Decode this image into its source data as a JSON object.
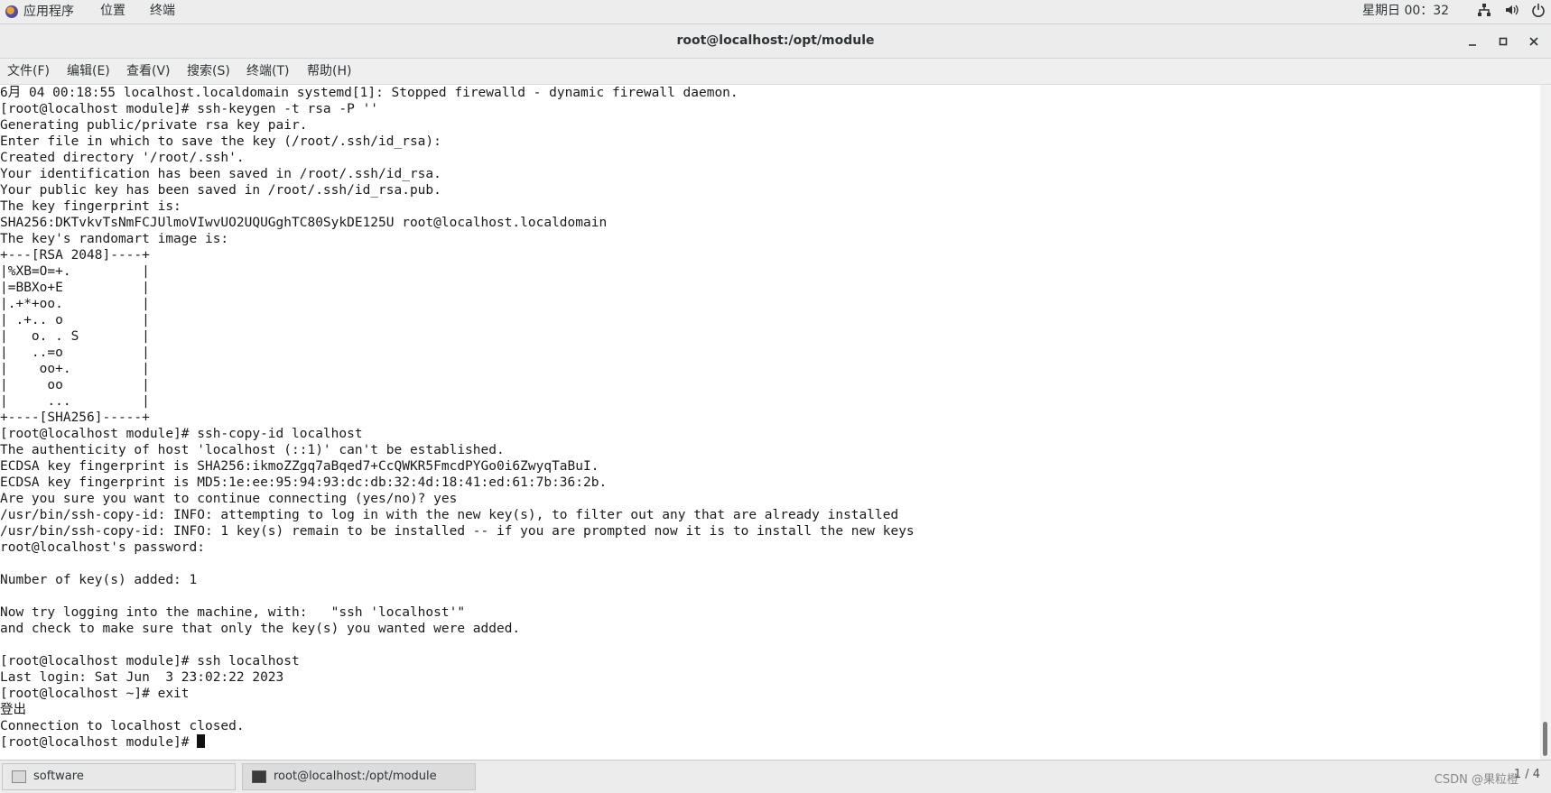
{
  "top_panel": {
    "applications_label": "应用程序",
    "places_label": "位置",
    "terminal_label": "终端",
    "clock": "星期日 00：32",
    "tray_icons": [
      "network-icon",
      "volume-icon",
      "power-icon"
    ]
  },
  "window": {
    "title": "root@localhost:/opt/module"
  },
  "menubar": {
    "items": [
      "文件(F)",
      "编辑(E)",
      "查看(V)",
      "搜索(S)",
      "终端(T)",
      "帮助(H)"
    ]
  },
  "terminal": {
    "lines": [
      "6月 04 00:18:55 localhost.localdomain systemd[1]: Stopped firewalld - dynamic firewall daemon.",
      "[root@localhost module]# ssh-keygen -t rsa -P ''",
      "Generating public/private rsa key pair.",
      "Enter file in which to save the key (/root/.ssh/id_rsa):",
      "Created directory '/root/.ssh'.",
      "Your identification has been saved in /root/.ssh/id_rsa.",
      "Your public key has been saved in /root/.ssh/id_rsa.pub.",
      "The key fingerprint is:",
      "SHA256:DKTvkvTsNmFCJUlmoVIwvUO2UQUGghTC80SykDE125U root@localhost.localdomain",
      "The key's randomart image is:",
      "+---[RSA 2048]----+",
      "|%XB=O=+.         |",
      "|=BBXo+E          |",
      "|.+*+oo.          |",
      "| .+.. o          |",
      "|   o. . S        |",
      "|   ..=o          |",
      "|    oo+.         |",
      "|     oo          |",
      "|     ...         |",
      "+----[SHA256]-----+",
      "[root@localhost module]# ssh-copy-id localhost",
      "The authenticity of host 'localhost (::1)' can't be established.",
      "ECDSA key fingerprint is SHA256:ikmoZZgq7aBqed7+CcQWKR5FmcdPYGo0i6ZwyqTaBuI.",
      "ECDSA key fingerprint is MD5:1e:ee:95:94:93:dc:db:32:4d:18:41:ed:61:7b:36:2b.",
      "Are you sure you want to continue connecting (yes/no)? yes",
      "/usr/bin/ssh-copy-id: INFO: attempting to log in with the new key(s), to filter out any that are already installed",
      "/usr/bin/ssh-copy-id: INFO: 1 key(s) remain to be installed -- if you are prompted now it is to install the new keys",
      "root@localhost's password:",
      "",
      "Number of key(s) added: 1",
      "",
      "Now try logging into the machine, with:   \"ssh 'localhost'\"",
      "and check to make sure that only the key(s) you wanted were added.",
      "",
      "[root@localhost module]# ssh localhost",
      "Last login: Sat Jun  3 23:02:22 2023",
      "[root@localhost ~]# exit",
      "登出",
      "Connection to localhost closed."
    ],
    "prompt": "[root@localhost module]# "
  },
  "taskbar": {
    "tasks": [
      "software",
      "root@localhost:/opt/module"
    ],
    "workspace": "1 / 4",
    "watermark": "CSDN @果粒橙"
  }
}
